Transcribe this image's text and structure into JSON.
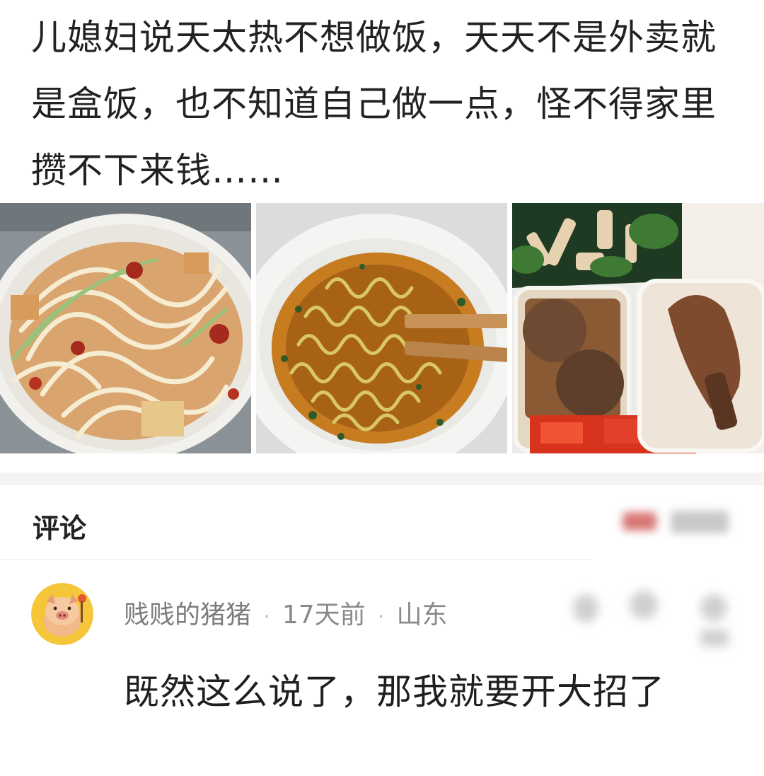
{
  "post": {
    "text": "儿媳妇说天太热不想做饭，天天不是外卖就是盒饭，也不知道自己做一点，怪不得家里攒不下来钱……"
  },
  "photos": [
    {
      "name": "noodle-bowl-photo"
    },
    {
      "name": "instant-noodle-photo"
    },
    {
      "name": "boxed-meal-photo"
    }
  ],
  "comments_section": {
    "title": "评论"
  },
  "comment": {
    "username": "贱贱的猪猪",
    "time": "17天前",
    "location": "山东",
    "text": "既然这么说了，那我就要开大招了"
  },
  "colors": {
    "text": "#222222",
    "meta": "#8a8a8a",
    "divider": "#f4f4f4"
  }
}
